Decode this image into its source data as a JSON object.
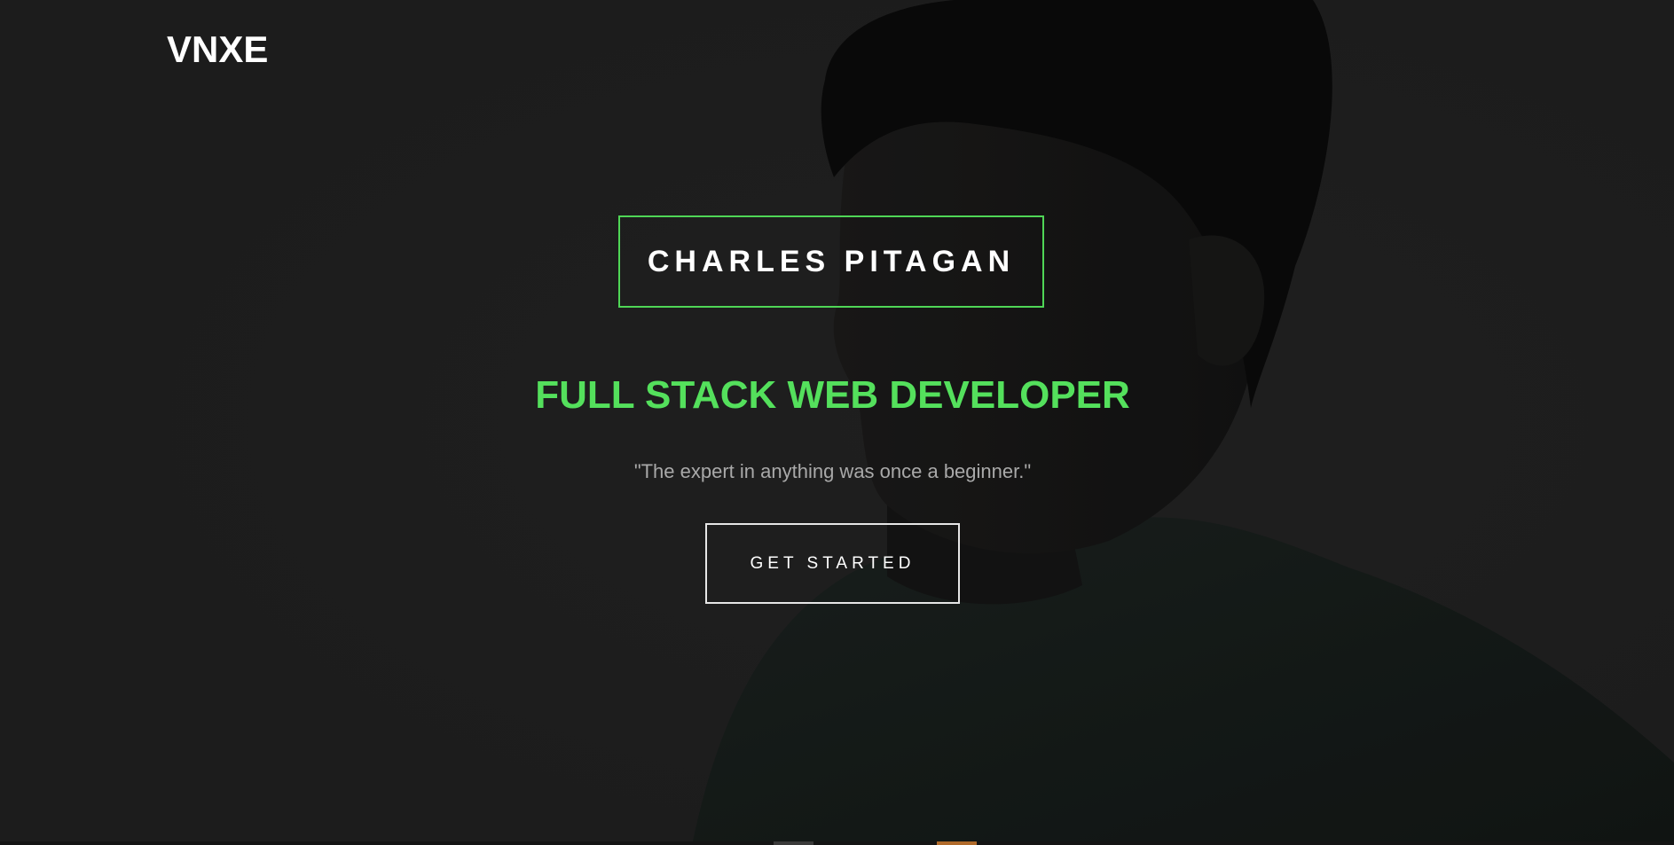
{
  "brand": {
    "logo_text": "VNXE"
  },
  "hero": {
    "name": "CHARLES PITAGAN",
    "role": "FULL STACK WEB DEVELOPER",
    "quote": "\"The expert in anything was once a beginner.\"",
    "cta_label": "GET STARTED",
    "background_image": "portrait-photo"
  },
  "colors": {
    "accent_green": "#54e05c",
    "name_border": "#4fd656",
    "text_white": "#ffffff",
    "quote_gray": "#a9a9a9",
    "background": "#252525"
  }
}
